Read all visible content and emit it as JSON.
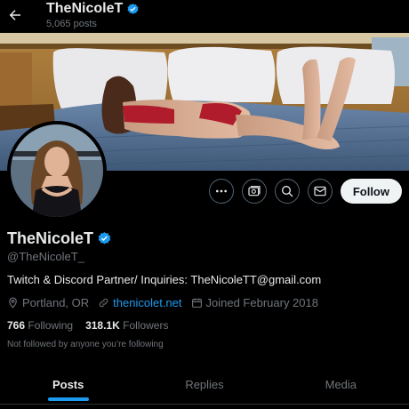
{
  "header": {
    "name": "TheNicoleT",
    "posts_count": "5,065 posts"
  },
  "profile": {
    "name": "TheNicoleT",
    "handle": "@TheNicoleT_",
    "bio": "Twitch & Discord Partner/ Inquiries: TheNicoleTT@gmail.com",
    "location": "Portland, OR",
    "website": "thenicolet.net",
    "joined": "Joined February 2018",
    "following_count": "766",
    "following_label": "Following",
    "followers_count": "318.1K",
    "followers_label": "Followers",
    "followed_by_note": "Not followed by anyone you’re following"
  },
  "actions": {
    "follow_label": "Follow"
  },
  "tabs": [
    {
      "label": "Posts",
      "active": true
    },
    {
      "label": "Replies",
      "active": false
    },
    {
      "label": "Media",
      "active": false
    }
  ],
  "colors": {
    "accent": "#1d9bf0",
    "background": "#000000",
    "verified": "#1d9bf0"
  },
  "icons": [
    "back-arrow-icon",
    "verified-badge-icon",
    "more-icon",
    "subscribe-icon",
    "search-icon",
    "message-icon",
    "location-icon",
    "link-icon",
    "calendar-icon"
  ]
}
